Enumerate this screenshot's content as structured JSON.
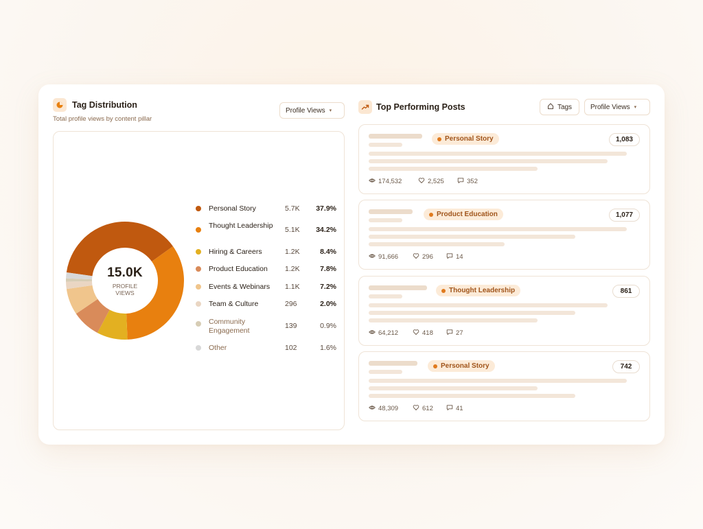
{
  "left_panel": {
    "title": "Tag Distribution",
    "subtitle": "Total profile views by content pillar",
    "dropdown_label": "Profile Views"
  },
  "donut": {
    "total": "15.0K",
    "unit_label": "PROFILE VIEWS"
  },
  "chart_data": {
    "type": "pie",
    "title": "Tag Distribution",
    "categories": [
      "Personal Story",
      "Thought Leadership",
      "Hiring & Careers",
      "Product Education",
      "Events & Webinars",
      "Team & Culture",
      "Community Engagement",
      "Other"
    ],
    "values": [
      37.9,
      34.2,
      8.4,
      7.8,
      7.2,
      2.0,
      0.9,
      1.6
    ],
    "colors": [
      "#c0590f",
      "#e8800f",
      "#e3b021",
      "#d98b5a",
      "#f0c58c",
      "#ead6c3",
      "#d7cdb5",
      "#d8d8d8"
    ]
  },
  "legend": [
    {
      "label": "Personal Story",
      "value": "5.7K",
      "pct": "37.9%",
      "color": "#c0590f",
      "bold": true
    },
    {
      "label": "Thought Leadership",
      "value": "5.1K",
      "pct": "34.2%",
      "color": "#e8800f",
      "bold": true
    },
    {
      "label": "Hiring & Careers",
      "value": "1.2K",
      "pct": "8.4%",
      "color": "#e3b021",
      "bold": true
    },
    {
      "label": "Product Education",
      "value": "1.2K",
      "pct": "7.8%",
      "color": "#d98b5a",
      "bold": true
    },
    {
      "label": "Events & Webinars",
      "value": "1.1K",
      "pct": "7.2%",
      "color": "#f0c58c",
      "bold": true
    },
    {
      "label": "Team & Culture",
      "value": "296",
      "pct": "2.0%",
      "color": "#ead6c3",
      "bold": true
    },
    {
      "label": "Community Engagement",
      "value": "139",
      "pct": "0.9%",
      "color": "#d7cdb5",
      "bold": false
    },
    {
      "label": "Other",
      "value": "102",
      "pct": "1.6%",
      "color": "#d8d8d8",
      "bold": false
    }
  ],
  "right_panel": {
    "title": "Top Performing Posts",
    "tags_label": "Tags",
    "dropdown_label": "Profile Views"
  },
  "posts": [
    {
      "tag": "Personal Story",
      "count": "1,083",
      "views": "174,532",
      "likes": "2,525",
      "comments": "352"
    },
    {
      "tag": "Product Education",
      "count": "1,077",
      "views": "91,666",
      "likes": "296",
      "comments": "14"
    },
    {
      "tag": "Thought Leadership",
      "count": "861",
      "views": "64,212",
      "likes": "418",
      "comments": "27"
    },
    {
      "tag": "Personal Story",
      "count": "742",
      "views": "48,309",
      "likes": "612",
      "comments": "41"
    }
  ],
  "icons": {
    "left_header": "pie-chart-icon",
    "right_header": "trending-up-icon",
    "tags": "tag-icon",
    "views": "eye-icon",
    "likes": "heart-icon",
    "comments": "comment-icon"
  },
  "colors": {
    "accent": "#e07a1e",
    "pill_bg": "#fcebd8",
    "pill_text": "#a0541a"
  }
}
